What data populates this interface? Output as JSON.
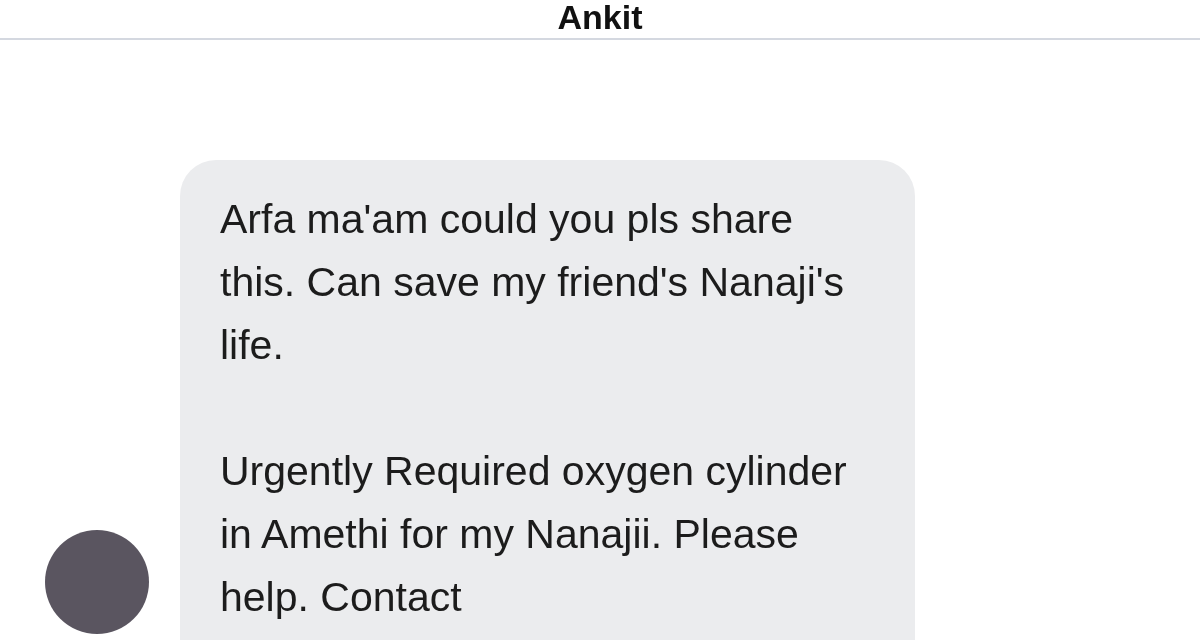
{
  "header": {
    "title": "Ankit"
  },
  "messages": [
    {
      "paragraphs": [
        "Arfa ma'am could you pls share this. Can save my friend's Nanaji's life.",
        "Urgently Required oxygen cylinder  in Amethi for my Nanajii. Please help. Contact"
      ]
    }
  ]
}
